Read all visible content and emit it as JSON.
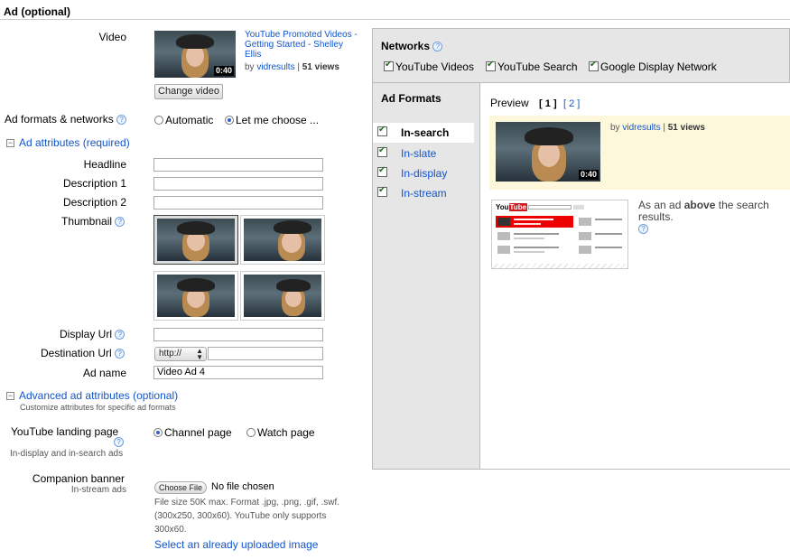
{
  "section_title": "Ad (optional)",
  "video": {
    "label": "Video",
    "title": "YouTube Promoted Videos - Getting Started - Shelley Ellis",
    "by_prefix": "by",
    "author": "vidresults",
    "views": "51 views",
    "duration": "0:40",
    "change_button": "Change video"
  },
  "formats_networks": {
    "label": "Ad formats & networks",
    "options": [
      "Automatic",
      "Let me choose ..."
    ],
    "selected": "Let me choose ..."
  },
  "ad_attributes": {
    "header": "Ad attributes (required)",
    "headline_label": "Headline",
    "headline_value": "",
    "description1_label": "Description 1",
    "description1_value": "",
    "description2_label": "Description 2",
    "description2_value": "",
    "thumbnail_label": "Thumbnail",
    "display_url_label": "Display Url",
    "display_url_value": "",
    "destination_url_label": "Destination Url",
    "protocol": "http://",
    "destination_url_value": "",
    "ad_name_label": "Ad name",
    "ad_name_value": "Video Ad 4"
  },
  "advanced": {
    "header": "Advanced ad attributes (optional)",
    "subtext": "Customize attributes for specific ad formats",
    "landing_label": "YouTube landing page",
    "landing_sub": "In-display and in-search ads",
    "landing_options": [
      "Channel page",
      "Watch page"
    ],
    "landing_selected": "Channel page",
    "companion_label": "Companion banner",
    "companion_sub": "In-stream ads",
    "choose_file": "Choose File",
    "no_file": "No file chosen",
    "file_info": "File size 50K max. Format .jpg, .png, .gif, .swf. (300x250, 300x60). YouTube only supports 300x60.",
    "select_uploaded": "Select an already uploaded image"
  },
  "networks": {
    "title": "Networks",
    "items": [
      {
        "label": "YouTube Videos",
        "checked": true
      },
      {
        "label": "YouTube Search",
        "checked": true
      },
      {
        "label": "Google Display Network",
        "checked": true
      }
    ]
  },
  "ad_formats": {
    "title": "Ad Formats",
    "items": [
      {
        "label": "In-search",
        "checked": true,
        "active": true
      },
      {
        "label": "In-slate",
        "checked": true,
        "active": false
      },
      {
        "label": "In-display",
        "checked": true,
        "active": false
      },
      {
        "label": "In-stream",
        "checked": true,
        "active": false
      }
    ]
  },
  "preview": {
    "label": "Preview",
    "pages": [
      "1",
      "2"
    ],
    "current_page": "1",
    "by_prefix": "by",
    "author": "vidresults",
    "views": "51 views",
    "duration": "0:40",
    "desc_pre": "As an ad",
    "desc_bold": "above",
    "desc_post": "the search results.",
    "mock_logo": "You"
  },
  "colors": {
    "link": "#1155cc",
    "panel_bg": "#e6e6e6",
    "preview_highlight": "#fdf8dc",
    "youtube_red": "#cc181e"
  }
}
